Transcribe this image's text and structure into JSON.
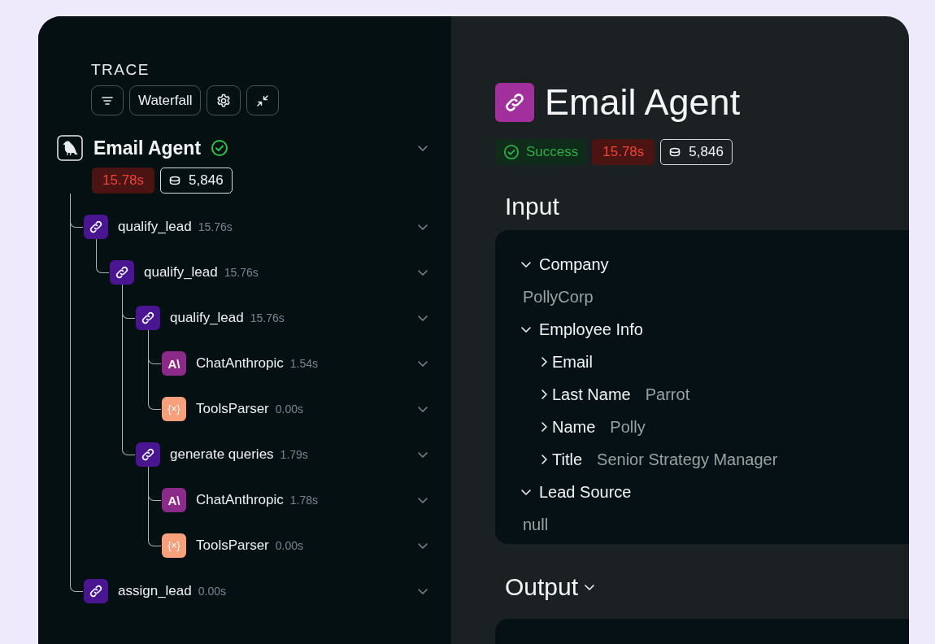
{
  "trace": {
    "heading": "TRACE",
    "toolbar": [
      {
        "kind": "filter"
      },
      {
        "kind": "text",
        "label": "Waterfall"
      },
      {
        "kind": "settings"
      },
      {
        "kind": "collapse"
      }
    ],
    "root": {
      "name": "Email Agent",
      "succeeded": true,
      "duration": "15.78s",
      "tokens": "5,846",
      "children": [
        {
          "kind": "chain",
          "name": "qualify_lead",
          "duration": "15.76s",
          "children": [
            {
              "kind": "chain",
              "name": "qualify_lead",
              "duration": "15.76s",
              "children": [
                {
                  "kind": "chain",
                  "name": "qualify_lead",
                  "duration": "15.76s",
                  "children": [
                    {
                      "kind": "llm",
                      "icon_text": "A\\",
                      "name": "ChatAnthropic",
                      "duration": "1.54s"
                    },
                    {
                      "kind": "parser",
                      "icon_text": "{×}",
                      "name": "ToolsParser",
                      "duration": "0.00s"
                    }
                  ]
                },
                {
                  "kind": "chain",
                  "name": "generate queries",
                  "duration": "1.79s",
                  "children": [
                    {
                      "kind": "llm",
                      "icon_text": "A\\",
                      "name": "ChatAnthropic",
                      "duration": "1.78s"
                    },
                    {
                      "kind": "parser",
                      "icon_text": "{×}",
                      "name": "ToolsParser",
                      "duration": "0.00s"
                    }
                  ]
                }
              ]
            }
          ]
        },
        {
          "kind": "chain",
          "name": "assign_lead",
          "duration": "0.00s"
        }
      ]
    }
  },
  "detail": {
    "title": "Email Agent",
    "status": {
      "kind": "success",
      "label": "Success"
    },
    "duration": "15.78s",
    "tokens": "5,846",
    "input": {
      "heading": "Input",
      "fields": [
        {
          "key": "Company",
          "expanded": true,
          "value": "PollyCorp"
        },
        {
          "key": "Employee Info",
          "expanded": true,
          "children": [
            {
              "key": "Email",
              "expanded": false
            },
            {
              "key": "Last Name",
              "expanded": false,
              "value": "Parrot"
            },
            {
              "key": "Name",
              "expanded": false,
              "value": "Polly"
            },
            {
              "key": "Title",
              "expanded": false,
              "value": "Senior Strategy Manager"
            }
          ]
        },
        {
          "key": "Lead Source",
          "expanded": true,
          "value": "null"
        }
      ]
    },
    "output": {
      "heading": "Output",
      "expanded": true
    }
  }
}
